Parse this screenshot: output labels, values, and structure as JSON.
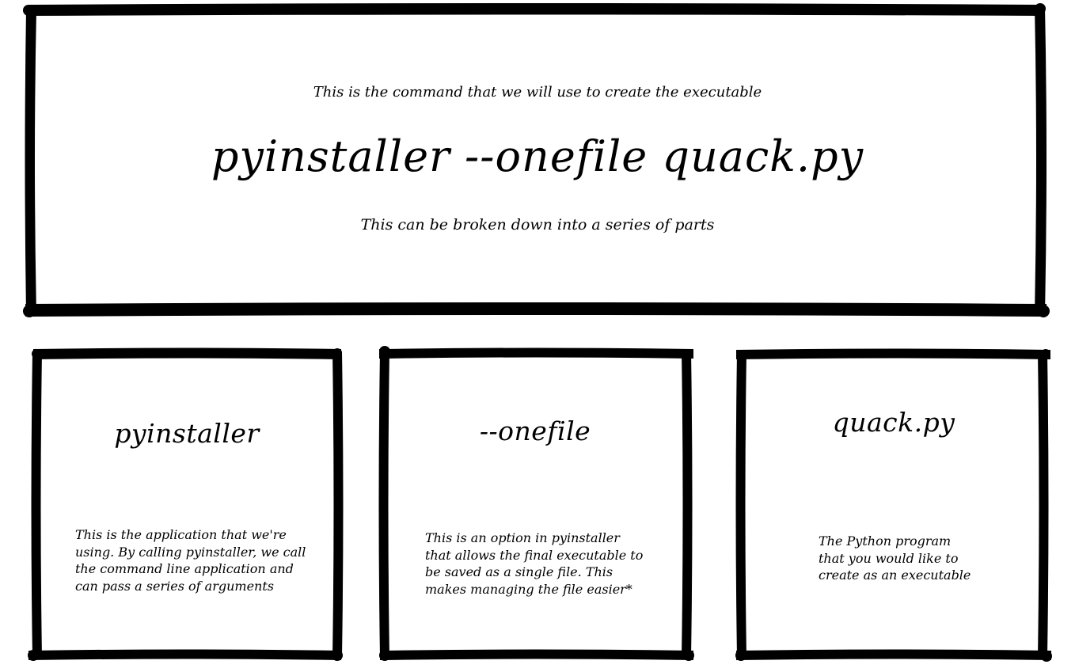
{
  "top": {
    "caption": "This is the command that we will use to create the executable",
    "command": "pyinstaller --onefile quack.py",
    "subcaption": "This can be broken down into a series of parts"
  },
  "cards": [
    {
      "title": "pyinstaller",
      "lines": [
        "This is the application that we're",
        "using. By calling pyinstaller, we call",
        "the command line application and",
        "can pass a series of arguments"
      ]
    },
    {
      "title": "--onefile",
      "lines": [
        "This is an option in pyinstaller",
        "that allows the final executable to",
        "be saved as a single file. This",
        "makes managing the file easier*"
      ]
    },
    {
      "title": "quack.py",
      "lines": [
        "The Python program",
        "that you would like to",
        "create as an executable"
      ]
    }
  ],
  "colors": {
    "ink": "#000000",
    "background": "#ffffff"
  }
}
